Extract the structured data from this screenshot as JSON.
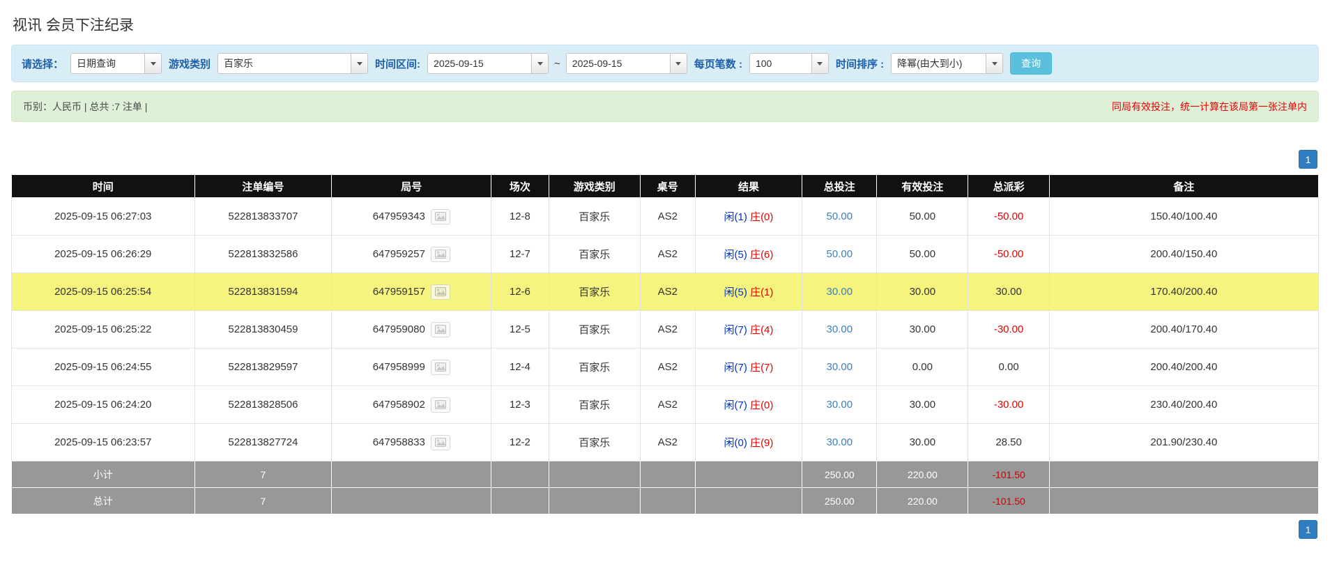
{
  "page": {
    "title": "视讯 会员下注纪录"
  },
  "filters": {
    "select_label": "请选择：",
    "select_value": "日期查询",
    "game_type_label": "游戏类别",
    "game_type_value": "百家乐",
    "date_range_label": "时间区间:",
    "date_from": "2025-09-15",
    "tilde": "~",
    "date_to": "2025-09-15",
    "page_size_label": "每页笔数 :",
    "page_size_value": "100",
    "sort_label": "时间排序 :",
    "sort_value": "降幂(由大到小)",
    "search_button": "查询"
  },
  "summary": {
    "left": "币别：人民币 | 总共 :7 注单 |",
    "right": "同局有效投注，统一计算在该局第一张注单内"
  },
  "pagination": {
    "page": "1"
  },
  "table": {
    "headers": [
      "时间",
      "注单编号",
      "局号",
      "场次",
      "游戏类别",
      "桌号",
      "结果",
      "总投注",
      "有效投注",
      "总派彩",
      "备注"
    ],
    "rows": [
      {
        "time": "2025-09-15 06:27:03",
        "bet_id": "522813833707",
        "round": "647959343",
        "session": "12-8",
        "game": "百家乐",
        "table_no": "AS2",
        "player": "闲(1)",
        "banker": "庄(0)",
        "total_bet": "50.00",
        "valid_bet": "50.00",
        "payout": "-50.00",
        "note": "150.40/100.40",
        "highlight": false
      },
      {
        "time": "2025-09-15 06:26:29",
        "bet_id": "522813832586",
        "round": "647959257",
        "session": "12-7",
        "game": "百家乐",
        "table_no": "AS2",
        "player": "闲(5)",
        "banker": "庄(6)",
        "total_bet": "50.00",
        "valid_bet": "50.00",
        "payout": "-50.00",
        "note": "200.40/150.40",
        "highlight": false
      },
      {
        "time": "2025-09-15 06:25:54",
        "bet_id": "522813831594",
        "round": "647959157",
        "session": "12-6",
        "game": "百家乐",
        "table_no": "AS2",
        "player": "闲(5)",
        "banker": "庄(1)",
        "total_bet": "30.00",
        "valid_bet": "30.00",
        "payout": "30.00",
        "note": "170.40/200.40",
        "highlight": true
      },
      {
        "time": "2025-09-15 06:25:22",
        "bet_id": "522813830459",
        "round": "647959080",
        "session": "12-5",
        "game": "百家乐",
        "table_no": "AS2",
        "player": "闲(7)",
        "banker": "庄(4)",
        "total_bet": "30.00",
        "valid_bet": "30.00",
        "payout": "-30.00",
        "note": "200.40/170.40",
        "highlight": false
      },
      {
        "time": "2025-09-15 06:24:55",
        "bet_id": "522813829597",
        "round": "647958999",
        "session": "12-4",
        "game": "百家乐",
        "table_no": "AS2",
        "player": "闲(7)",
        "banker": "庄(7)",
        "total_bet": "30.00",
        "valid_bet": "0.00",
        "payout": "0.00",
        "note": "200.40/200.40",
        "highlight": false
      },
      {
        "time": "2025-09-15 06:24:20",
        "bet_id": "522813828506",
        "round": "647958902",
        "session": "12-3",
        "game": "百家乐",
        "table_no": "AS2",
        "player": "闲(7)",
        "banker": "庄(0)",
        "total_bet": "30.00",
        "valid_bet": "30.00",
        "payout": "-30.00",
        "note": "230.40/200.40",
        "highlight": false
      },
      {
        "time": "2025-09-15 06:23:57",
        "bet_id": "522813827724",
        "round": "647958833",
        "session": "12-2",
        "game": "百家乐",
        "table_no": "AS2",
        "player": "闲(0)",
        "banker": "庄(9)",
        "total_bet": "30.00",
        "valid_bet": "30.00",
        "payout": "28.50",
        "note": "201.90/230.40",
        "highlight": false
      }
    ],
    "subtotal": {
      "label": "小计",
      "count": "7",
      "total_bet": "250.00",
      "valid_bet": "220.00",
      "payout": "-101.50"
    },
    "total": {
      "label": "总计",
      "count": "7",
      "total_bet": "250.00",
      "valid_bet": "220.00",
      "payout": "-101.50"
    }
  }
}
